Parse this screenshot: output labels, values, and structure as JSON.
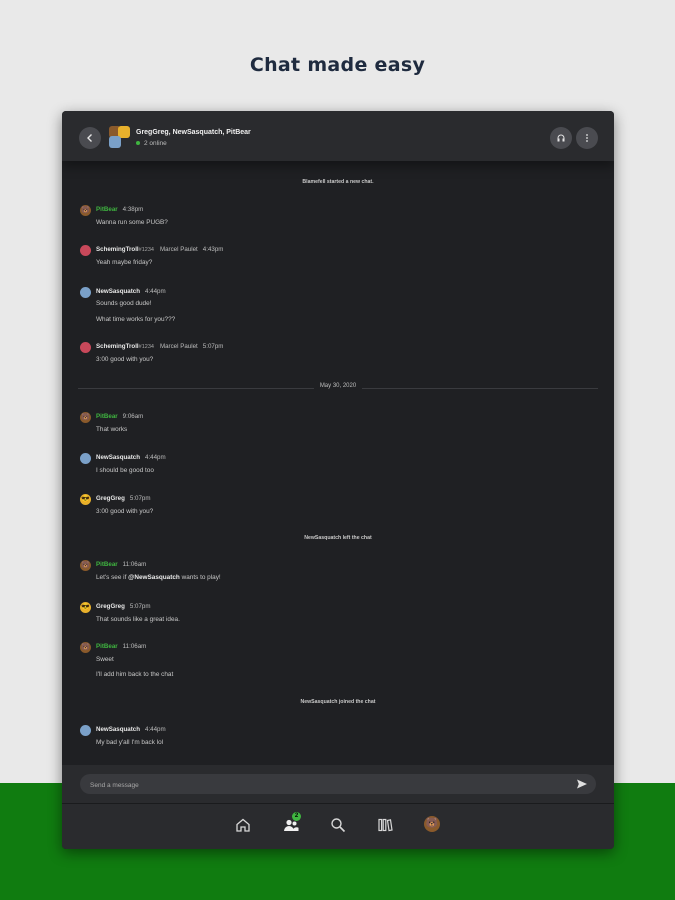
{
  "headline": "Chat made easy",
  "conversation": {
    "title": "GregGreg, NewSasquatch, PitBear",
    "online": "2 online"
  },
  "system_top": "Blamefell started a new chat.",
  "messages_day1": [
    {
      "name": "PitBear",
      "time": "4:38pm",
      "lines": [
        "Wanna run some PUGB?"
      ]
    },
    {
      "name": "SchemingTroll",
      "tag": "#1234",
      "real_name": "Marcel Paulet",
      "time": "4:43pm",
      "lines": [
        "Yeah maybe friday?"
      ]
    },
    {
      "name": "NewSasquatch",
      "time": "4:44pm",
      "lines": [
        "Sounds good dude!",
        "What time works for you???"
      ]
    },
    {
      "name": "SchemingTroll",
      "tag": "#1234",
      "real_name": "Marcel Paulet",
      "time": "5:07pm",
      "lines": [
        "3:00 good with you?"
      ]
    }
  ],
  "date_separator": "May 30, 2020",
  "messages_day2a": [
    {
      "name": "PitBear",
      "time": "9:06am",
      "lines": [
        "That works"
      ]
    },
    {
      "name": "NewSasquatch",
      "time": "4:44pm",
      "lines": [
        "I should be good too"
      ]
    },
    {
      "name": "GregGreg",
      "time": "5:07pm",
      "lines": [
        "3:00 good with you?"
      ]
    }
  ],
  "system_left": "NewSasquatch left the chat",
  "messages_day2b": [
    {
      "name": "PitBear",
      "time": "11:06am",
      "line_prefix": "Let's see if ",
      "mention": "@NewSasquatch",
      "line_suffix": " wants to play!"
    },
    {
      "name": "GregGreg",
      "time": "5:07pm",
      "lines": [
        "That sounds like a great idea."
      ]
    },
    {
      "name": "PitBear",
      "time": "11:06am",
      "lines": [
        "Sweet",
        "I'll add him back to the chat"
      ]
    }
  ],
  "system_joined": "NewSasquatch joined the chat",
  "messages_day2c": [
    {
      "name": "NewSasquatch",
      "time": "4:44pm",
      "lines": [
        "My bad y'all I'm back lol"
      ]
    }
  ],
  "compose": {
    "placeholder": "Send a message"
  },
  "nav": {
    "friends_badge": "2"
  },
  "colors": {
    "accent": "#3fb540",
    "brand_green": "#107c10",
    "app_bg": "#1f2023"
  }
}
